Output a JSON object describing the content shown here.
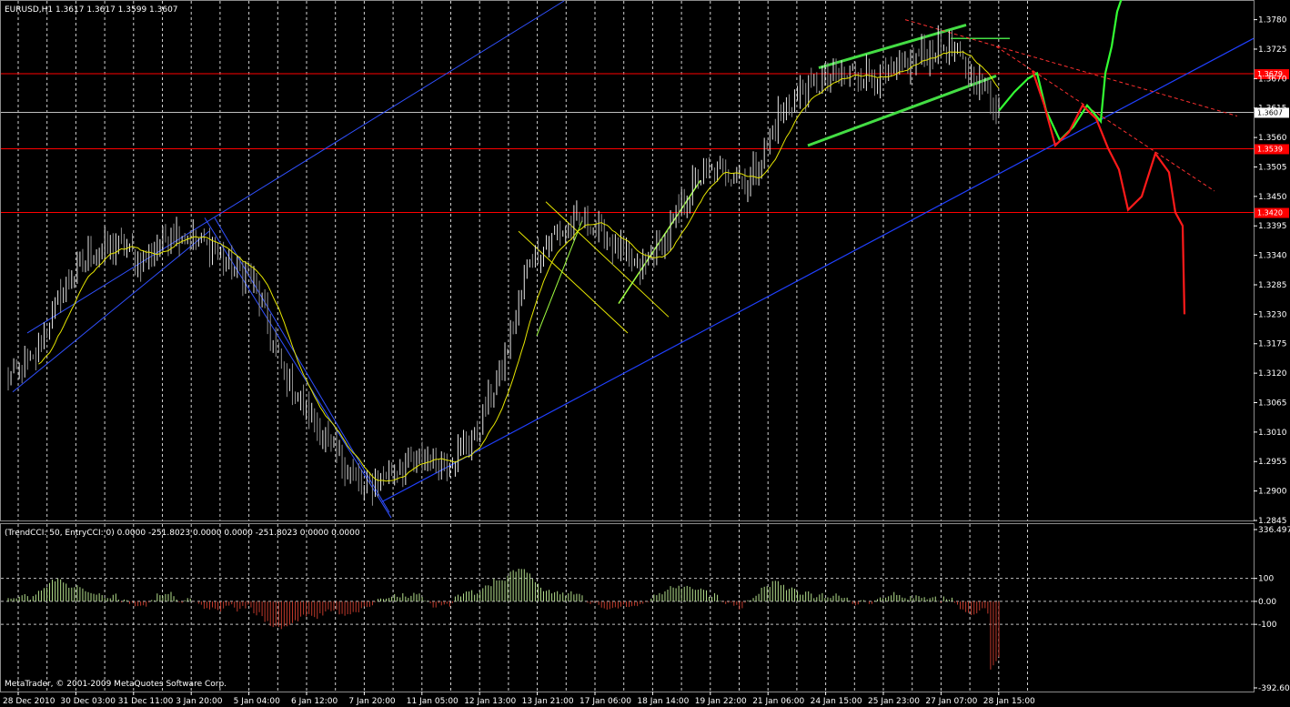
{
  "chart_data": {
    "type": "candlestick",
    "main": {
      "title": "EURUSD,H1  1.3617 1.3617 1.3599 1.3607",
      "ylim": [
        1.2845,
        1.3815
      ],
      "y_ticks": [
        "1.3780",
        "1.3725",
        "1.3670",
        "1.3615",
        "1.3560",
        "1.3505",
        "1.3450",
        "1.3395",
        "1.3340",
        "1.3285",
        "1.3230",
        "1.3175",
        "1.3120",
        "1.3065",
        "1.3010",
        "1.2955",
        "1.2900",
        "1.2845"
      ],
      "hlines": [
        {
          "label": "1.3679",
          "value": 1.3679,
          "color": "#ff0000"
        },
        {
          "label": "1.3607",
          "value": 1.3607,
          "color": "#c0c0c0",
          "text": "#000000",
          "bg": "#ffffff"
        },
        {
          "label": "1.3539",
          "value": 1.3539,
          "color": "#ff0000"
        },
        {
          "label": "1.3420",
          "value": 1.342,
          "color": "#ff0000"
        }
      ],
      "sessions_close": [
        1.311,
        1.314,
        1.327,
        1.334,
        1.336,
        1.333,
        1.339,
        1.337,
        1.333,
        1.329,
        1.313,
        1.304,
        1.297,
        1.29,
        1.294,
        1.296,
        1.296,
        1.3,
        1.313,
        1.333,
        1.338,
        1.341,
        1.336,
        1.331,
        1.338,
        1.348,
        1.35,
        1.348,
        1.36,
        1.365,
        1.367,
        1.368,
        1.367,
        1.371,
        1.373,
        1.368,
        1.362
      ]
    },
    "indicator": {
      "title": "(TrendCCI: 50, EntryCCI: 0)  0.0000 -251.8023 0.0000 0.0000 -251.8023 0.0000 0.0000",
      "ylim": [
        -392.608,
        336.497
      ],
      "y_ticks": [
        "336.497",
        "100",
        "0.00",
        "-100",
        "-392.608"
      ],
      "levels": [
        100,
        0,
        -100
      ]
    },
    "x_ticks": [
      "28 Dec 2010",
      "30 Dec 03:00",
      "31 Dec 11:00",
      "3 Jan 20:00",
      "5 Jan 04:00",
      "6 Jan 12:00",
      "7 Jan 20:00",
      "11 Jan 05:00",
      "12 Jan 13:00",
      "13 Jan 21:00",
      "17 Jan 06:00",
      "18 Jan 14:00",
      "19 Jan 22:00",
      "21 Jan 06:00",
      "24 Jan 15:00",
      "25 Jan 23:00",
      "27 Jan 07:00",
      "28 Jan 15:00"
    ],
    "colors": {
      "bull": "#b4e08c",
      "bear": "#c0392b",
      "ma": "#e6e600",
      "trend_blue": "#2040ff",
      "pred_up": "#33ff33",
      "pred_down": "#ff1a1a"
    }
  },
  "footer": {
    "copyright": "MetaTrader, © 2001-2009 MetaQuotes Software Corp."
  }
}
